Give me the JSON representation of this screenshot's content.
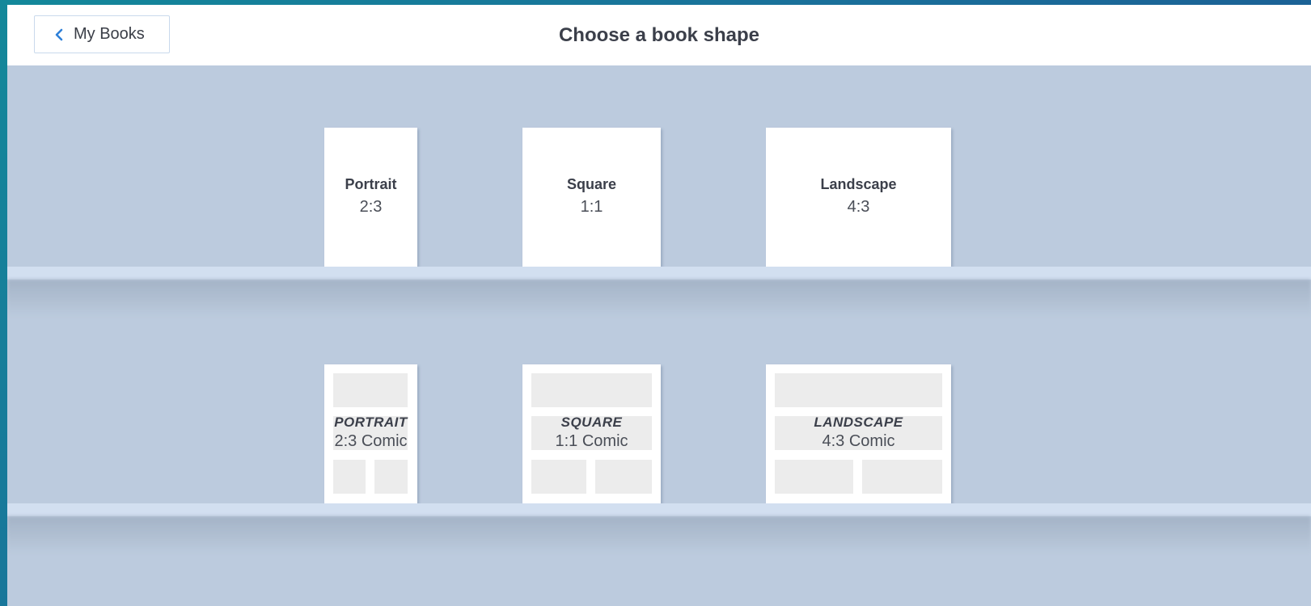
{
  "header": {
    "back_label": "My Books",
    "title": "Choose a book shape"
  },
  "shelves": {
    "standard": [
      {
        "name": "Portrait",
        "ratio": "2:3"
      },
      {
        "name": "Square",
        "ratio": "1:1"
      },
      {
        "name": "Landscape",
        "ratio": "4:3"
      }
    ],
    "comic": [
      {
        "name": "PORTRAIT",
        "ratio": "2:3 Comic"
      },
      {
        "name": "SQUARE",
        "ratio": "1:1 Comic"
      },
      {
        "name": "LANDSCAPE",
        "ratio": "4:3 Comic"
      }
    ]
  },
  "colors": {
    "accent": "#2f80d8",
    "background": "#bccbde",
    "shelf": "#d2dff0"
  }
}
